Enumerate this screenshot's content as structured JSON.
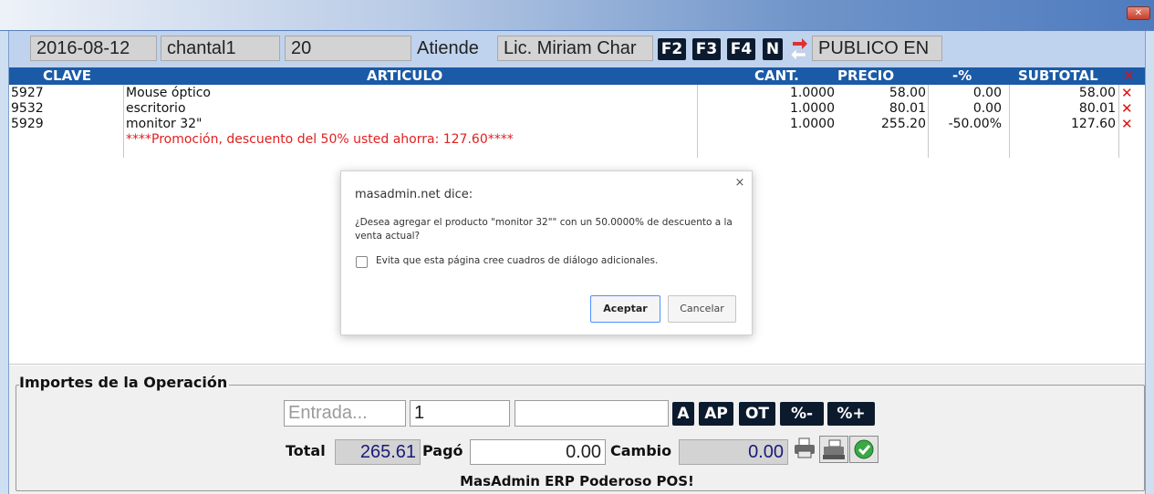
{
  "window": {
    "close_label": "✕"
  },
  "topbar": {
    "date": "2016-08-12",
    "user": "chantal1",
    "number": "20",
    "attends_label": "Atiende",
    "attendant": "Lic. Miriam Char",
    "keys": [
      "F2",
      "F3",
      "F4",
      "N"
    ],
    "customer": "PUBLICO EN"
  },
  "grid": {
    "columns": [
      "CLAVE",
      "ARTICULO",
      "CANT.",
      "PRECIO",
      "-%",
      "SUBTOTAL"
    ],
    "rows": [
      {
        "clave": "5927",
        "articulo": "Mouse óptico",
        "cant": "1.0000",
        "precio": "58.00",
        "pct": "0.00",
        "subtotal": "58.00"
      },
      {
        "clave": "9532",
        "articulo": "escritorio",
        "cant": "1.0000",
        "precio": "80.01",
        "pct": "0.00",
        "subtotal": "80.01"
      },
      {
        "clave": "5929",
        "articulo": "monitor 32\"",
        "cant": "1.0000",
        "precio": "255.20",
        "pct": "-50.00%",
        "subtotal": "127.60"
      }
    ],
    "promo": "****Promoción, descuento del 50% usted ahorra: 127.60****",
    "delete_glyph": "✕"
  },
  "dialog": {
    "title": "masadmin.net dice:",
    "close_glyph": "×",
    "message": "¿Desea agregar el producto \"monitor 32\"\" con un 50.0000% de descuento a la venta actual?",
    "checkbox_label": "Evita que esta página cree cuadros de diálogo adicionales.",
    "ok_label": "Aceptar",
    "cancel_label": "Cancelar"
  },
  "importes": {
    "title": "Importes de la Operación",
    "entrada_placeholder": "Entrada...",
    "qty_value": "1",
    "code_value": "",
    "buttons": [
      "A",
      "AP",
      "OT",
      "%-",
      "%+"
    ],
    "total_label": "Total",
    "total_value": "265.61",
    "pago_label": "Pagó",
    "pago_value": "0.00",
    "cambio_label": "Cambio",
    "cambio_value": "0.00",
    "footer": "MasAdmin ERP Poderoso POS!"
  }
}
